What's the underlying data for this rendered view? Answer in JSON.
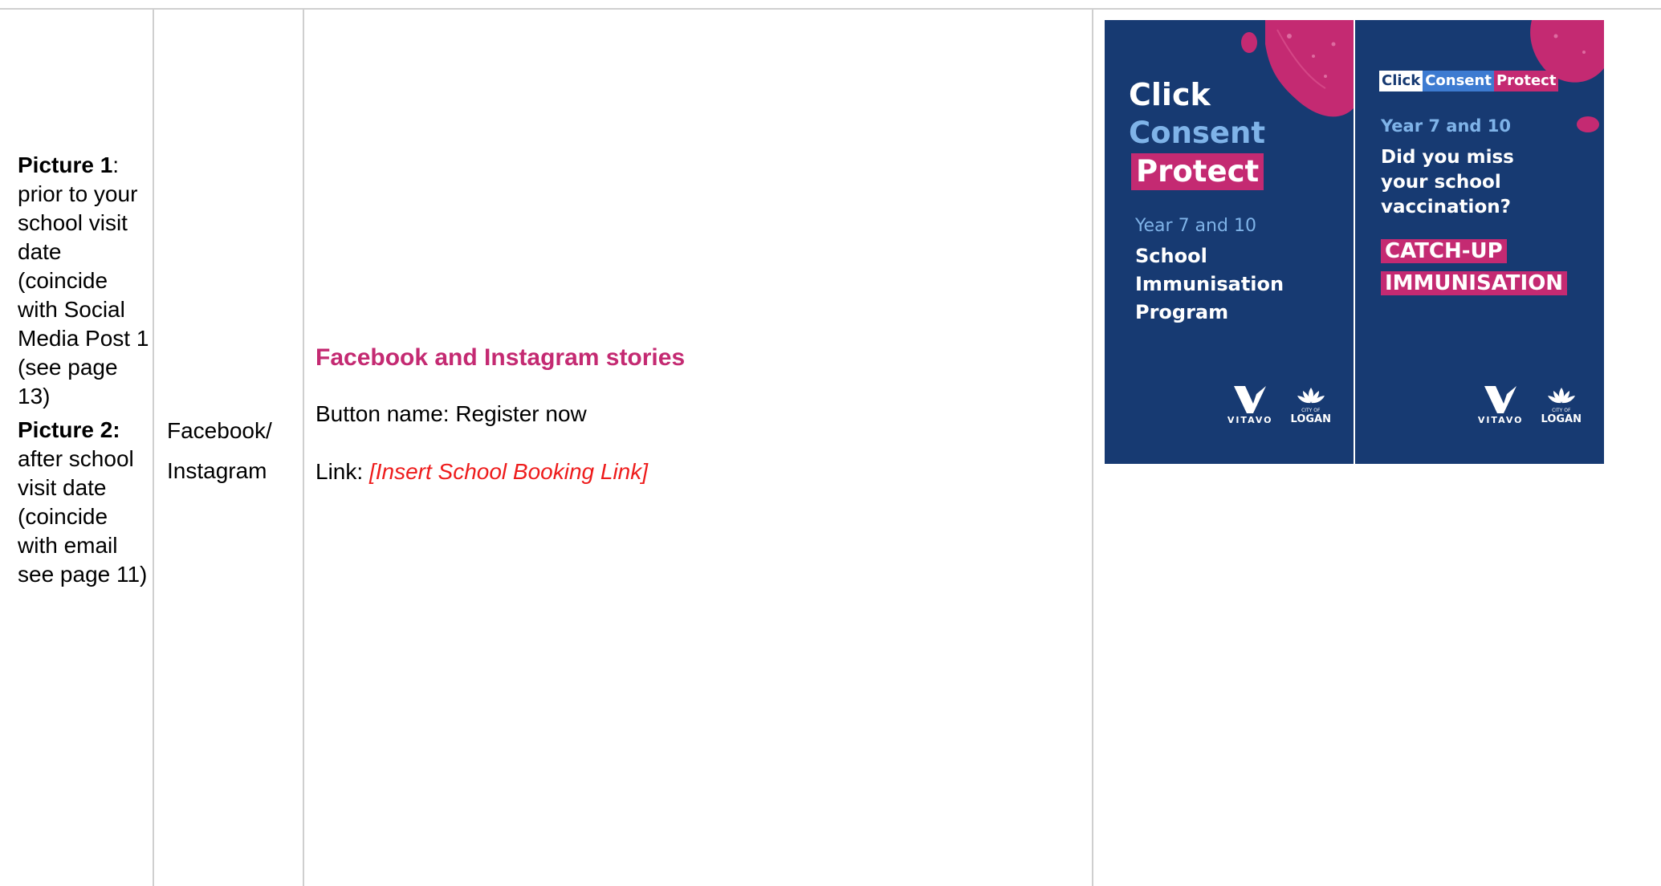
{
  "row": {
    "timing": {
      "picture1_label": "Picture 1",
      "picture1_colon": ":",
      "picture1_text": "prior to your school visit date (coincide with Social Media Post 1 (see page 13)",
      "picture2_label": "Picture 2:",
      "picture2_text": "after school visit date (coincide with email see page 11)"
    },
    "channel": {
      "line1": "Facebook/",
      "line2": "Instagram"
    },
    "content": {
      "heading": "Facebook and Instagram stories",
      "button_line": "Button name: Register now",
      "link_prefix": "Link: ",
      "link_placeholder": "[Insert School Booking Link]"
    }
  },
  "posters": [
    {
      "line_click": "Click",
      "line_consent": "Consent",
      "line_protect": "Protect",
      "year": "Year 7 and 10",
      "program_1": "School",
      "program_2": "Immunisation",
      "program_3": "Program",
      "logo_vitavo": "VITAVO",
      "logo_city": "CITY OF",
      "logo_logan": "LOGAN"
    },
    {
      "tag_click": "Click",
      "tag_consent": "Consent",
      "tag_protect": "Protect",
      "year": "Year 7 and 10",
      "question_1": "Did you miss",
      "question_2": "your school",
      "question_3": "vaccination?",
      "catchup_1": "CATCH-UP",
      "catchup_2": "IMMUNISATION",
      "logo_vitavo": "VITAVO",
      "logo_city": "CITY OF",
      "logo_logan": "LOGAN"
    }
  ],
  "colors": {
    "navy": "#173a72",
    "pink": "#c42a72",
    "light_blue": "#7fb3e8",
    "link_red": "#ee1c1c"
  }
}
